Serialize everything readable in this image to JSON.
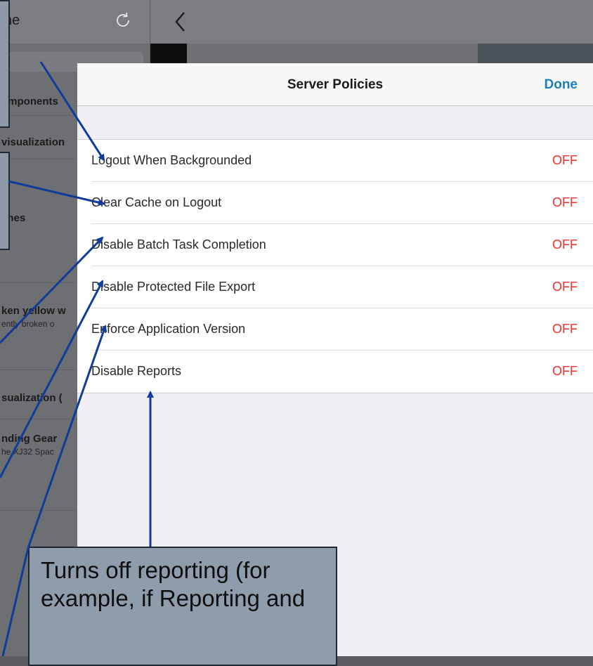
{
  "topbar": {
    "title_fragment": "he",
    "refresh_icon": "refresh-icon",
    "back_icon": "chevron-left-icon"
  },
  "sidebar": {
    "rows": [
      {
        "title": "omponents",
        "subtitle": ""
      },
      {
        "title": "visualization",
        "subtitle": ""
      },
      {
        "title": "ches",
        "subtitle": ""
      },
      {
        "title": "ken yellow w",
        "subtitle": "ently broken o"
      },
      {
        "title": "sualization (",
        "subtitle": ""
      },
      {
        "title": "nding Gear",
        "subtitle": "he XJ32 Spac"
      }
    ]
  },
  "modal": {
    "title": "Server Policies",
    "done_label": "Done",
    "policies": [
      {
        "label": "Logout When Backgrounded",
        "value": "OFF"
      },
      {
        "label": "Clear Cache on Logout",
        "value": "OFF"
      },
      {
        "label": "Disable Batch Task Completion",
        "value": "OFF"
      },
      {
        "label": "Disable Protected File Export",
        "value": "OFF"
      },
      {
        "label": "Enforce Application Version",
        "value": "OFF"
      },
      {
        "label": "Disable Reports",
        "value": "OFF"
      }
    ]
  },
  "callout": {
    "text": "Turns off reporting (for example, if Reporting and"
  },
  "colors": {
    "accent": "#1d7fb8",
    "off_value": "#f0302a",
    "arrow": "#0f3c9a",
    "callout_bg": "#8f9cab"
  }
}
